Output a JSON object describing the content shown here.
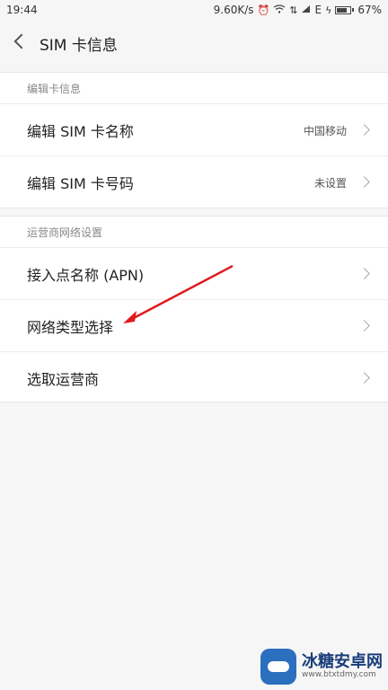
{
  "status_bar": {
    "time": "19:44",
    "speed": "9.60K/s",
    "network_type": "E",
    "battery": "67%",
    "icons": [
      "alarm-icon",
      "wifi-icon",
      "signal-icon",
      "charging-icon",
      "battery-icon"
    ]
  },
  "header": {
    "title": "SIM 卡信息"
  },
  "sections": [
    {
      "header": "编辑卡信息",
      "items": [
        {
          "label": "编辑 SIM 卡名称",
          "value": "中国移动"
        },
        {
          "label": "编辑 SIM 卡号码",
          "value": "未设置"
        }
      ]
    },
    {
      "header": "运营商网络设置",
      "items": [
        {
          "label": "接入点名称 (APN)",
          "value": ""
        },
        {
          "label": "网络类型选择",
          "value": ""
        },
        {
          "label": "选取运营商",
          "value": ""
        }
      ]
    }
  ],
  "annotation": {
    "arrow_color": "#e0191b"
  },
  "watermark": {
    "title": "冰糖安卓网",
    "url": "www.btxtdmy.com"
  }
}
